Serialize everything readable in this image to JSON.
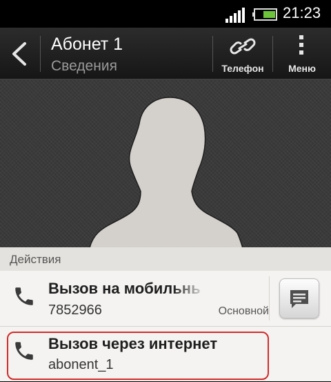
{
  "status_bar": {
    "time": "21:23",
    "signal_icon": "signal-icon",
    "battery_icon": "battery-icon",
    "battery_color": "#6dc33c"
  },
  "header": {
    "title": "Абонет 1",
    "subtitle": "Сведения",
    "back_icon": "back-arrow-icon",
    "link_button": {
      "label": "Телефон",
      "icon": "link-icon"
    },
    "menu_button": {
      "label": "Меню",
      "icon": "more-vert-icon"
    }
  },
  "photo": {
    "icon": "contact-silhouette-icon"
  },
  "actions": {
    "section_title": "Действия",
    "items": [
      {
        "title": "Вызов на мобильный",
        "subtitle": "7852966",
        "tag": "Основной",
        "icon": "phone-icon",
        "message_icon": "message-icon"
      },
      {
        "title": "Вызов через интернет",
        "subtitle": "abonent_1",
        "icon": "phone-icon"
      }
    ]
  },
  "colors": {
    "highlight": "#d22a2a",
    "list_bg": "#f4f3f1",
    "header_bg": "#e4e2de"
  }
}
